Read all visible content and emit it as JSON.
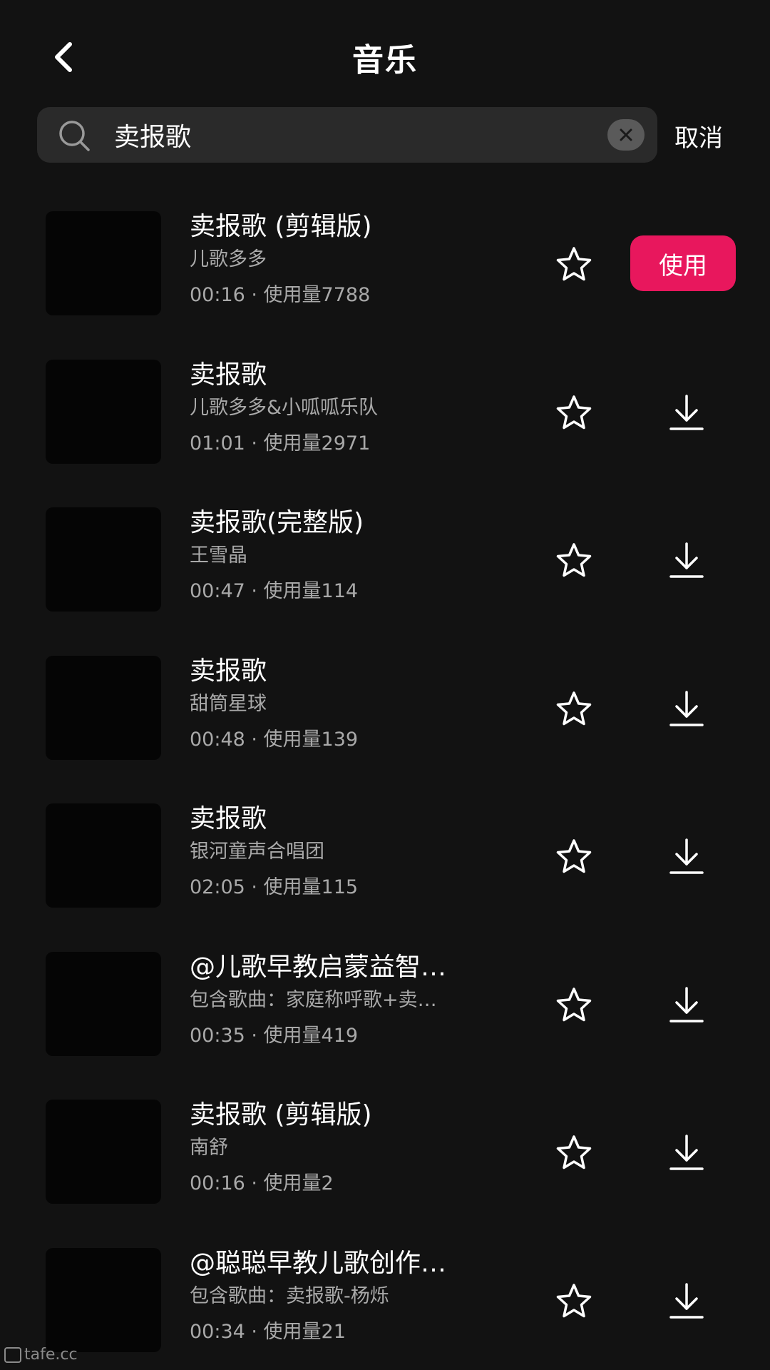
{
  "header": {
    "title": "音乐",
    "back_icon": "chevron-left-icon"
  },
  "search": {
    "value": "卖报歌",
    "placeholder": "",
    "cancel_label": "取消",
    "icon": "search-icon",
    "clear_icon": "clear-icon"
  },
  "colors": {
    "background": "#121212",
    "search_bg": "#2a2a2a",
    "accent": "#e8175d",
    "secondary_text": "#a9a9a9"
  },
  "songs": [
    {
      "title": "卖报歌 (剪辑版)",
      "artist": "儿歌多多",
      "meta": "00:16 · 使用量7788",
      "action": "使用"
    },
    {
      "title": "卖报歌",
      "artist": "儿歌多多&小呱呱乐队",
      "meta": "01:01 · 使用量2971"
    },
    {
      "title": "卖报歌(完整版)",
      "artist": "王雪晶",
      "meta": "00:47 · 使用量114"
    },
    {
      "title": "卖报歌",
      "artist": "甜筒星球",
      "meta": "00:48 · 使用量139"
    },
    {
      "title": "卖报歌",
      "artist": "银河童声合唱团",
      "meta": "02:05 · 使用量115"
    },
    {
      "title": "@儿歌早教启蒙益智…",
      "artist": "包含歌曲：家庭称呼歌+卖…",
      "meta": "00:35 · 使用量419"
    },
    {
      "title": "卖报歌 (剪辑版)",
      "artist": "南舒",
      "meta": "00:16 · 使用量2"
    },
    {
      "title": "@聪聪早教儿歌创作…",
      "artist": "包含歌曲：卖报歌-杨烁",
      "meta": "00:34 · 使用量21"
    }
  ],
  "watermark": "tafe.cc"
}
